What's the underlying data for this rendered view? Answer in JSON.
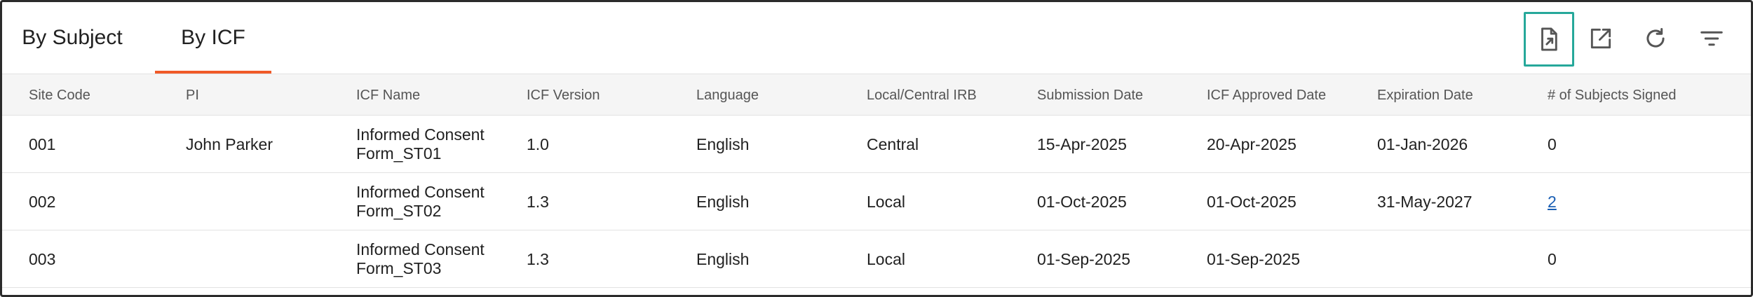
{
  "tabs": [
    {
      "label": "By Subject",
      "active": false
    },
    {
      "label": "By ICF",
      "active": true
    }
  ],
  "toolbar": {
    "icons": [
      "export-icon",
      "open-external-icon",
      "refresh-icon",
      "filter-icon"
    ],
    "highlight_color": "#26a89a"
  },
  "accent_color": "#f05a28",
  "table": {
    "columns": [
      "Site Code",
      "PI",
      "ICF Name",
      "ICF Version",
      "Language",
      "Local/Central IRB",
      "Submission Date",
      "ICF Approved Date",
      "Expiration Date",
      "# of Subjects Signed"
    ],
    "rows": [
      {
        "site_code": "001",
        "pi": "John Parker",
        "icf_name": "Informed Consent Form_ST01",
        "icf_version": "1.0",
        "language": "English",
        "irb": "Central",
        "submission_date": "15-Apr-2025",
        "approved_date": "20-Apr-2025",
        "expiration_date": "01-Jan-2026",
        "subjects_signed": "0"
      },
      {
        "site_code": "002",
        "pi": "",
        "icf_name": "Informed Consent Form_ST02",
        "icf_version": "1.3",
        "language": "English",
        "irb": "Local",
        "submission_date": "01-Oct-2025",
        "approved_date": "01-Oct-2025",
        "expiration_date": "31-May-2027",
        "subjects_signed": "2"
      },
      {
        "site_code": "003",
        "pi": "",
        "icf_name": "Informed Consent Form_ST03",
        "icf_version": "1.3",
        "language": "English",
        "irb": "Local",
        "submission_date": "01-Sep-2025",
        "approved_date": "01-Sep-2025",
        "expiration_date": "",
        "subjects_signed": "0"
      }
    ]
  }
}
